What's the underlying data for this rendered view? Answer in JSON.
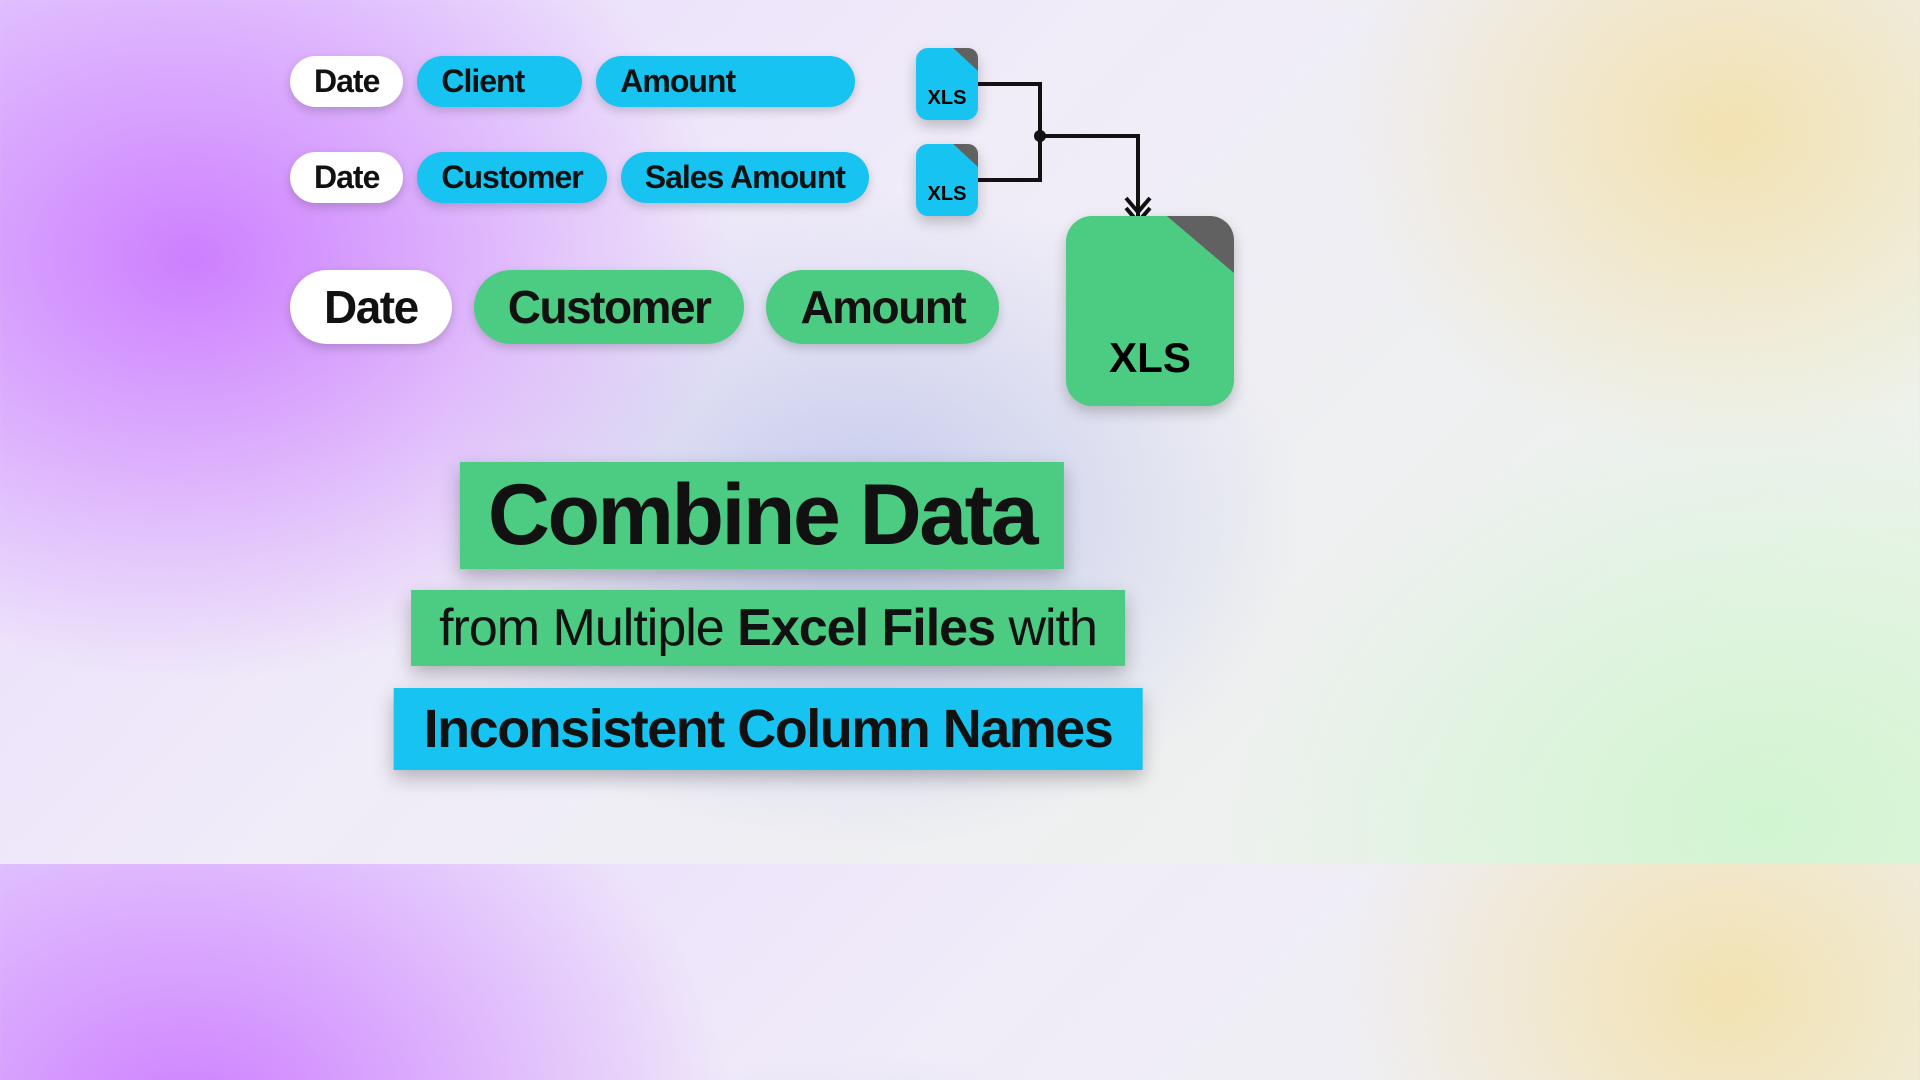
{
  "source_rows": [
    {
      "columns": [
        "Date",
        "Client",
        "Amount"
      ],
      "styles": [
        "white",
        "cyan",
        "cyan"
      ],
      "file_label": "XLS"
    },
    {
      "columns": [
        "Date",
        "Customer",
        "Sales Amount"
      ],
      "styles": [
        "white",
        "cyan",
        "cyan"
      ],
      "file_label": "XLS"
    }
  ],
  "result_row": {
    "columns": [
      "Date",
      "Customer",
      "Amount"
    ],
    "styles": [
      "white",
      "green",
      "green"
    ],
    "file_label": "XLS"
  },
  "title": {
    "line1": "Combine Data",
    "line2_pre": "from Multiple ",
    "line2_bold": "Excel Files",
    "line2_post": " with",
    "line3": "Inconsistent Column Names"
  },
  "colors": {
    "cyan": "#17C3F0",
    "green": "#4CCB83",
    "white": "#ffffff"
  }
}
